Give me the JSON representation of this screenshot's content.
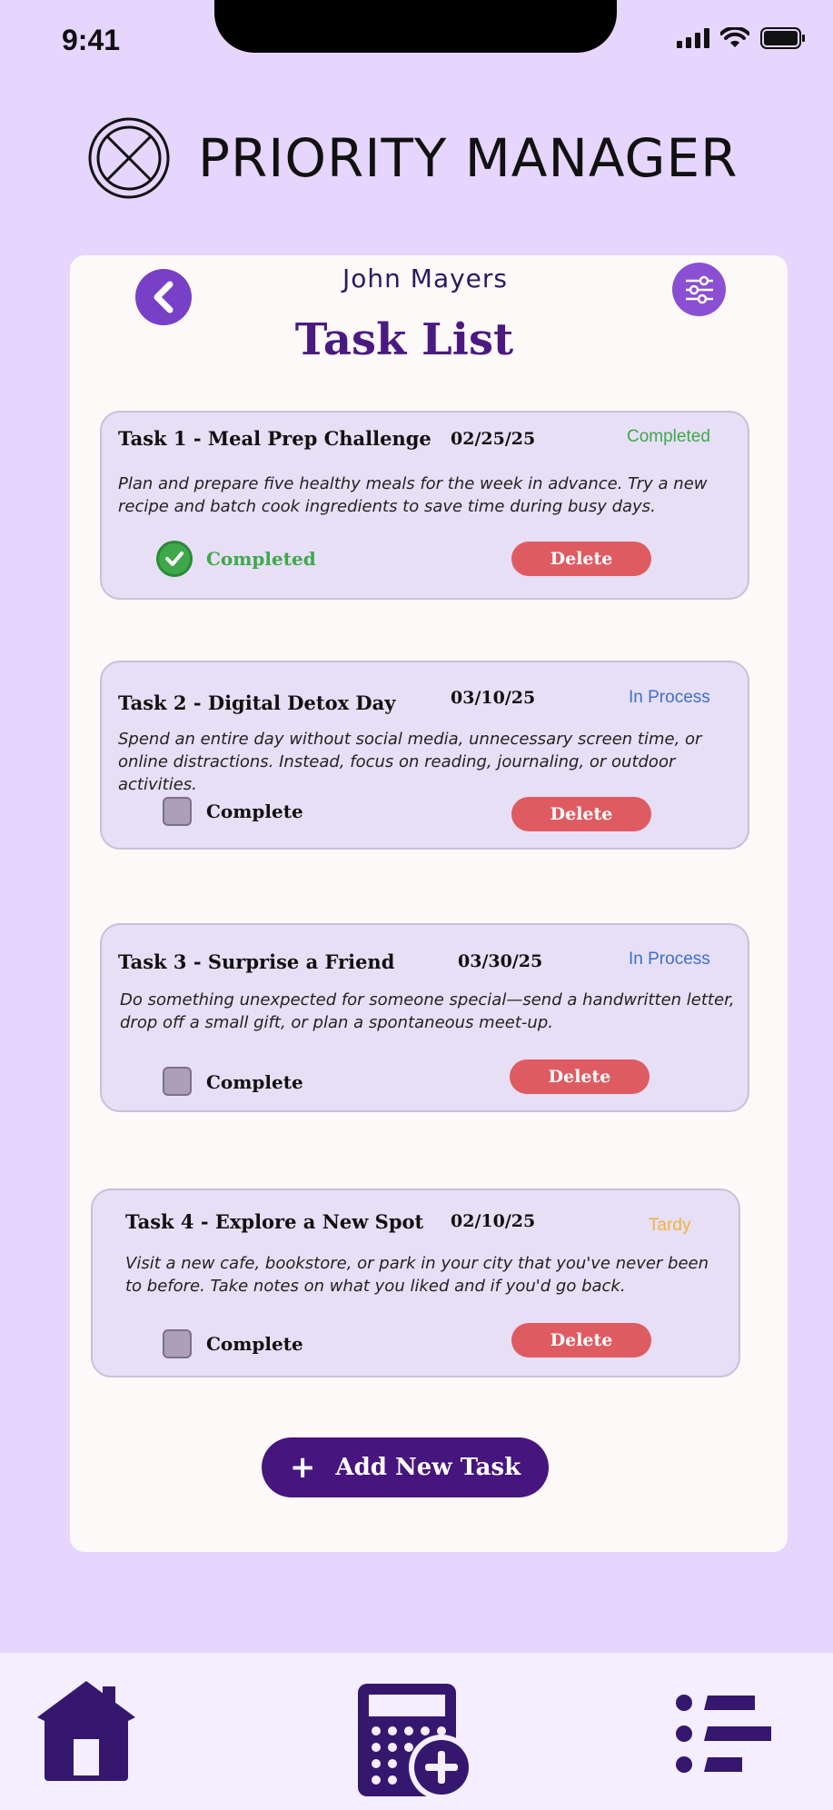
{
  "status_bar": {
    "time": "9:41"
  },
  "app": {
    "title": "PRIORITY MANAGER",
    "logo": "circle-x-logo"
  },
  "header": {
    "user_name": "John Mayers",
    "page_title": "Task List",
    "back_icon": "chevron-left-icon",
    "filter_icon": "sliders-icon"
  },
  "tasks": [
    {
      "title": "Task 1 - Meal Prep Challenge",
      "date": "02/25/25",
      "status": "Completed",
      "status_color": "#3fa84a",
      "description": "Plan and prepare five healthy meals for the week in advance. Try a new recipe and batch cook ingredients to save time during busy days.",
      "checked": true,
      "check_label": "Completed",
      "delete_label": "Delete"
    },
    {
      "title": "Task 2 - Digital Detox Day",
      "date": "03/10/25",
      "status": "In Process",
      "status_color": "#3f6fc9",
      "description": "Spend an entire day without social media, unnecessary screen time, or online distractions. Instead, focus on reading, journaling, or outdoor activities.",
      "checked": false,
      "check_label": "Complete",
      "delete_label": "Delete"
    },
    {
      "title": "Task 3 - Surprise a Friend",
      "date": "03/30/25",
      "status": "In Process",
      "status_color": "#3f6fc9",
      "description": "Do something unexpected for someone special—send a handwritten letter, drop off a small gift, or plan a spontaneous meet-up.",
      "checked": false,
      "check_label": "Complete",
      "delete_label": "Delete"
    },
    {
      "title": "Task 4 - Explore a New Spot",
      "date": "02/10/25",
      "status": "Tardy",
      "status_color": "#f2b33d",
      "description": "Visit a new cafe, bookstore, or park in your city that you've never been to before. Take notes on what you liked and if you'd go back.",
      "checked": false,
      "check_label": "Complete",
      "delete_label": "Delete"
    }
  ],
  "add_button": {
    "label": "Add New Task",
    "icon": "plus-icon"
  },
  "bottom_nav": {
    "items": [
      "home-icon",
      "calendar-add-icon",
      "list-icon"
    ]
  }
}
